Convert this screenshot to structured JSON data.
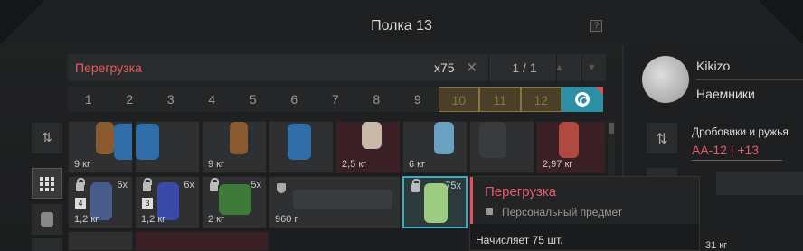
{
  "window": {
    "title": "Полка 13",
    "help": "?"
  },
  "search": {
    "label": "Перегрузка",
    "count": "x75",
    "clear": "✕",
    "pager": "1 / 1",
    "prev": "▲",
    "next": "▼"
  },
  "tabs": [
    "1",
    "2",
    "3",
    "4",
    "5",
    "6",
    "7",
    "8",
    "9",
    "10",
    "11",
    "12"
  ],
  "items_row1": [
    {
      "weight": "9 кг"
    },
    {
      "weight": "9 кг"
    },
    {
      "weight": "2,5 кг"
    },
    {
      "weight": "6 кг"
    },
    {
      "weight": ""
    },
    {
      "weight": "2,97 кг"
    }
  ],
  "items_row2": [
    {
      "weight": "1,2 кг",
      "qty": "6x",
      "badge": "4"
    },
    {
      "weight": "1,2 кг",
      "qty": "6x",
      "badge": "3"
    },
    {
      "weight": "2 кг",
      "qty": "5x"
    },
    {
      "weight": "960 г"
    },
    {
      "weight": "",
      "qty": "75x"
    }
  ],
  "tooltip": {
    "name": "Перегрузка",
    "subtitle": "Персональный предмет",
    "desc": "Начисляет 75 шт."
  },
  "profile": {
    "nick": "Kikizo",
    "faction": "Наемники"
  },
  "weapon": {
    "category": "Дробовики и ружья",
    "name": "AA-12 | +13",
    "weight": "31 кг"
  },
  "colors": {
    "accent": "#2d8fa6",
    "danger": "#e85a5a",
    "gold": "#8a7440"
  }
}
